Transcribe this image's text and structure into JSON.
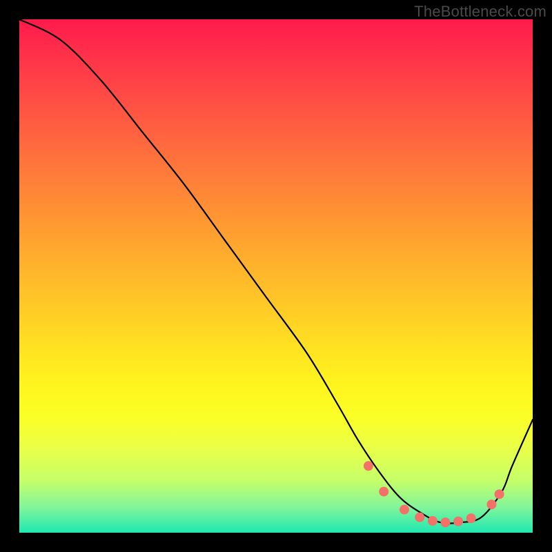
{
  "watermark": "TheBottleneck.com",
  "chart_data": {
    "type": "line",
    "title": "",
    "xlabel": "",
    "ylabel": "",
    "xlim": [
      0,
      100
    ],
    "ylim": [
      0,
      100
    ],
    "grid": false,
    "legend": "none",
    "series": [
      {
        "name": "curve",
        "color": "#000000",
        "x": [
          0,
          8,
          16,
          24,
          32,
          40,
          48,
          56,
          62,
          66,
          70,
          74,
          78,
          82,
          86,
          90,
          94,
          96,
          100
        ],
        "y": [
          100,
          96,
          88,
          78,
          68,
          57,
          46,
          35,
          25,
          18,
          12,
          7,
          4,
          2,
          2,
          3,
          8,
          13,
          22
        ]
      }
    ],
    "markers": [
      {
        "x": 68.0,
        "y": 13.0,
        "r": 7
      },
      {
        "x": 71.0,
        "y": 8.0,
        "r": 7
      },
      {
        "x": 75.0,
        "y": 4.5,
        "r": 7
      },
      {
        "x": 78.0,
        "y": 3.0,
        "r": 7
      },
      {
        "x": 80.5,
        "y": 2.3,
        "r": 7
      },
      {
        "x": 83.0,
        "y": 2.0,
        "r": 7
      },
      {
        "x": 85.5,
        "y": 2.2,
        "r": 7
      },
      {
        "x": 88.0,
        "y": 2.8,
        "r": 7
      },
      {
        "x": 92.0,
        "y": 5.5,
        "r": 7
      },
      {
        "x": 93.5,
        "y": 7.5,
        "r": 7
      }
    ],
    "marker_color": "#f37168"
  }
}
